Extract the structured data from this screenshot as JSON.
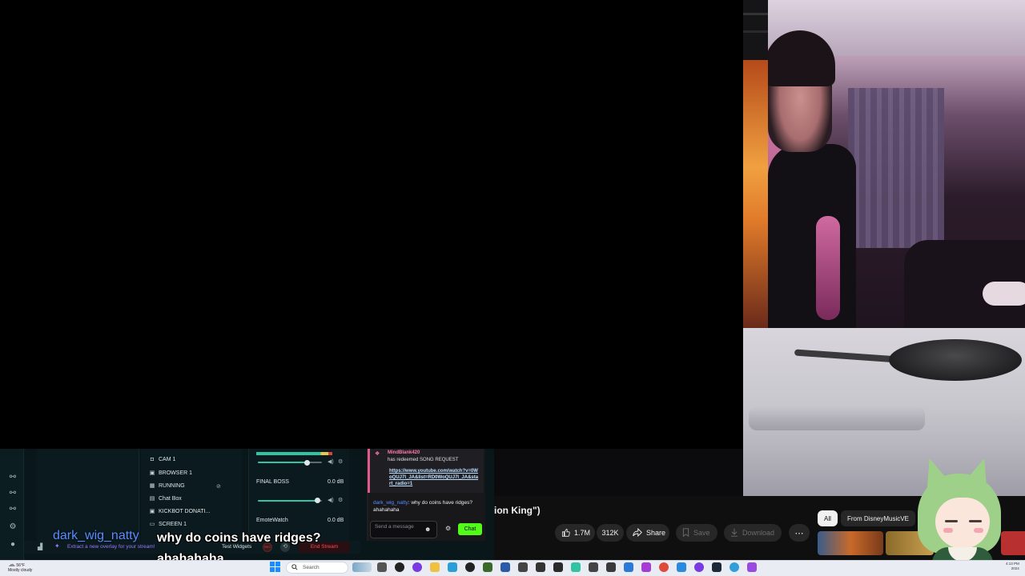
{
  "chat": {
    "redeem_user": "MindBlank420",
    "redeem_text": "has redeemed SONG REQUEST",
    "redeem_link": "https://www.youtube.com/watch?v=0WoQUJ7I_JA&list=RD0WoQUJ7I_JA&start_radio=1",
    "message_user": "dark_wig_natty",
    "message_text": "why do coins have ridges? ahahahaha",
    "input_placeholder": "Send a message",
    "send_label": "Chat"
  },
  "sources": [
    "CAM 1",
    "BROWSER 1",
    "RUNNING",
    "Chat Box",
    "KICKBOT DONATI...",
    "SCREEN 1"
  ],
  "mixer": {
    "channels": [
      {
        "name": "FINAL BOSS",
        "db": "0.0 dB",
        "level": 0.93
      },
      {
        "name": "EmoteWatch",
        "db": "0.0 dB",
        "level": 0.93
      }
    ]
  },
  "dock": {
    "extract_text": "Extract a new overlay for your stream!",
    "test_widgets": "Test Widgets",
    "rec_label": "REC",
    "end_stream": "End Stream"
  },
  "caption": {
    "user": "dark_wig_natty",
    "message": "why do coins have ridges? ahahahaha"
  },
  "youtube": {
    "title_fragment": "ion King\")",
    "likes": "1.7M",
    "dislikes": "312K",
    "share": "Share",
    "save": "Save",
    "download": "Download",
    "more": "⋯",
    "chips": [
      "All",
      "From DisneyMusicVE"
    ]
  },
  "taskbar": {
    "weather_temp": "56°F",
    "weather_desc": "Mostly cloudy",
    "search_placeholder": "Search",
    "time": "4:13 PM",
    "date": "2024"
  },
  "icons": {
    "like": "thumbs-up-icon",
    "share": "share-icon",
    "save": "bookmark-icon",
    "download": "download-icon"
  },
  "colors": {
    "streamlabs_bg": "#09161a",
    "chat_send": "#53fc18",
    "end_stream": "#ff4a5a",
    "username": "#5a8dff"
  }
}
